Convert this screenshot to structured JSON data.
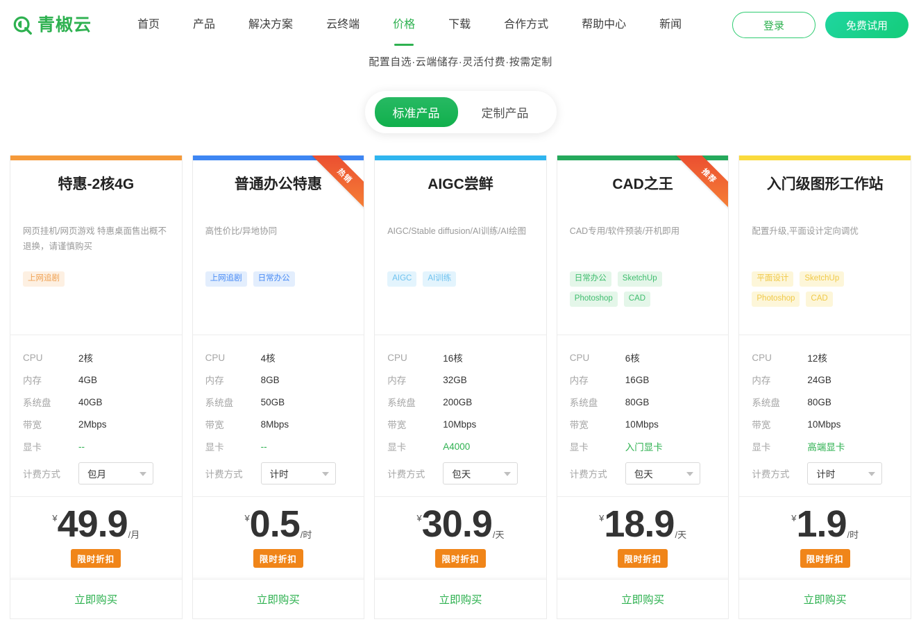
{
  "header": {
    "logo_text": "青椒云",
    "logo_icon": "q-circle-logo-icon",
    "nav": [
      {
        "label": "首页",
        "active": false
      },
      {
        "label": "产品",
        "active": false
      },
      {
        "label": "解决方案",
        "active": false
      },
      {
        "label": "云终端",
        "active": false
      },
      {
        "label": "价格",
        "active": true
      },
      {
        "label": "下载",
        "active": false
      },
      {
        "label": "合作方式",
        "active": false
      },
      {
        "label": "帮助中心",
        "active": false
      },
      {
        "label": "新闻",
        "active": false
      }
    ],
    "login_label": "登录",
    "trial_label": "免费试用",
    "subtitle": "配置自选·云端储存·灵活付费·按需定制",
    "accent_color": "#2eb150",
    "trial_color": "#16d48a"
  },
  "tabs": [
    {
      "label": "标准产品",
      "active": true
    },
    {
      "label": "定制产品",
      "active": false
    }
  ],
  "spec_labels": {
    "cpu": "CPU",
    "memory": "内存",
    "disk": "系统盘",
    "bandwidth": "带宽",
    "gpu": "显卡",
    "billing": "计费方式"
  },
  "currency": "¥",
  "discount_label": "限时折扣",
  "buy_label": "立即购买",
  "cards": [
    {
      "title": "特惠-2核4G",
      "top_color": "#f59a3a",
      "ribbon": "",
      "desc": "网页挂机/网页游戏 特惠桌面售出概不退换，请谨慎购买",
      "tag_bg": "#fdf0e2",
      "tag_fg": "#f0a254",
      "tags": [
        "上网追剧"
      ],
      "cpu": "2核",
      "memory": "4GB",
      "disk": "40GB",
      "bandwidth": "2Mbps",
      "gpu": "--",
      "billing": "包月",
      "price": "49.9",
      "unit": "/月"
    },
    {
      "title": "普通办公特惠",
      "top_color": "#3e86f3",
      "ribbon": "热销",
      "desc": "高性价比/异地协同",
      "tag_bg": "#e3eefd",
      "tag_fg": "#4a8cf5",
      "tags": [
        "上网追剧",
        "日常办公"
      ],
      "cpu": "4核",
      "memory": "8GB",
      "disk": "50GB",
      "bandwidth": "8Mbps",
      "gpu": "--",
      "billing": "计时",
      "price": "0.5",
      "unit": "/时"
    },
    {
      "title": "AIGC尝鲜",
      "top_color": "#2fb5ef",
      "ribbon": "",
      "desc": "AIGC/Stable diffusion/AI训练/AI绘图",
      "tag_bg": "#e3f4fd",
      "tag_fg": "#6fc2ef",
      "tags": [
        "AIGC",
        "AI训练"
      ],
      "cpu": "16核",
      "memory": "32GB",
      "disk": "200GB",
      "bandwidth": "10Mbps",
      "gpu": "A4000",
      "billing": "包天",
      "price": "30.9",
      "unit": "/天"
    },
    {
      "title": "CAD之王",
      "top_color": "#25a95c",
      "ribbon": "推荐",
      "desc": "CAD专用/软件预装/开机即用",
      "tag_bg": "#e4f6e9",
      "tag_fg": "#3fbd6e",
      "tags": [
        "日常办公",
        "SketchUp",
        "Photoshop",
        "CAD"
      ],
      "cpu": "6核",
      "memory": "16GB",
      "disk": "80GB",
      "bandwidth": "10Mbps",
      "gpu": "入门显卡",
      "billing": "包天",
      "price": "18.9",
      "unit": "/天"
    },
    {
      "title": "入门级图形工作站",
      "top_color": "#fada3c",
      "ribbon": "",
      "desc": "配置升级,平面设计定向调优",
      "tag_bg": "#fdf6d9",
      "tag_fg": "#f0c948",
      "tags": [
        "平面设计",
        "SketchUp",
        "Photoshop",
        "CAD"
      ],
      "cpu": "12核",
      "memory": "24GB",
      "disk": "80GB",
      "bandwidth": "10Mbps",
      "gpu": "高端显卡",
      "billing": "计时",
      "price": "1.9",
      "unit": "/时"
    }
  ]
}
